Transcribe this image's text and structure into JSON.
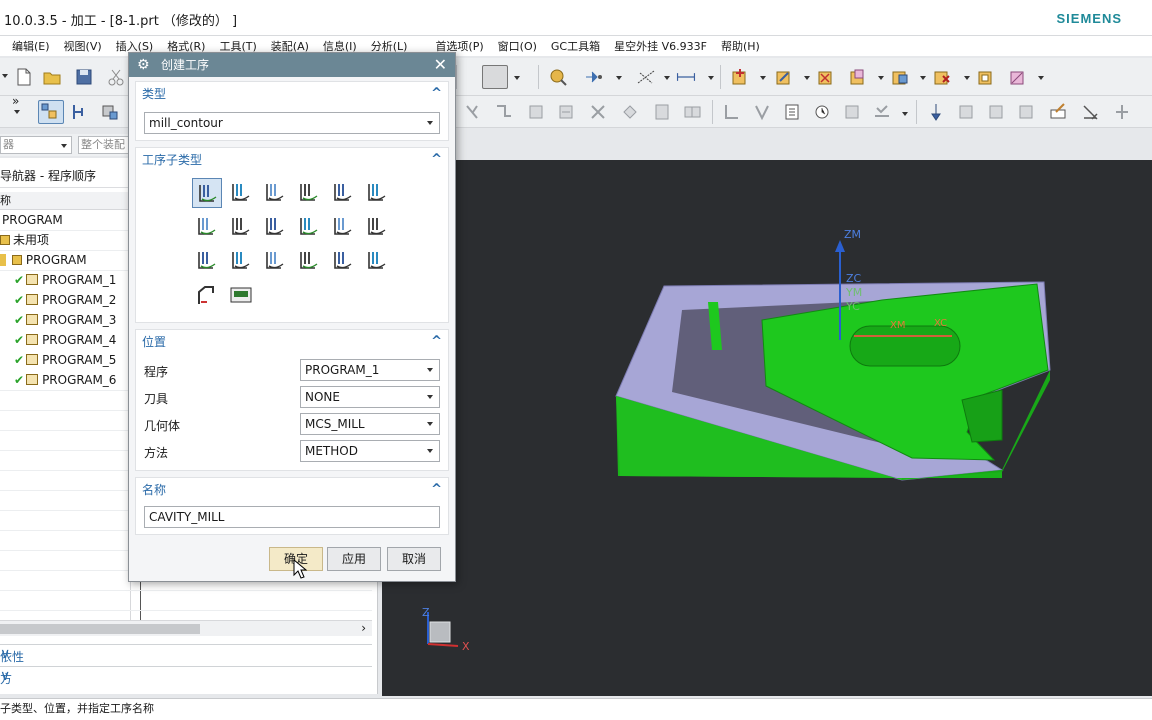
{
  "window": {
    "title": "10.0.3.5 - 加工 - [8-1.prt （修改的） ]",
    "brand": "SIEMENS"
  },
  "menubar": {
    "items": [
      "编辑(E)",
      "视图(V)",
      "插入(S)",
      "格式(R)",
      "工具(T)",
      "装配(A)",
      "信息(I)",
      "分析(L)",
      "首选项(P)",
      "窗口(O)",
      "GC工具箱",
      "星空外挂 V6.933F",
      "帮助(H)"
    ]
  },
  "toolbar2": {
    "filter_placeholder": "器",
    "assembly_placeholder": "整个装配"
  },
  "navigator": {
    "title": "导航器 - 程序顺序",
    "column_header": "称",
    "items": [
      {
        "label": "PROGRAM",
        "checked": false
      },
      {
        "label": "未用项",
        "checked": false
      },
      {
        "label": "PROGRAM",
        "checked": false
      },
      {
        "label": "PROGRAM_1",
        "checked": true
      },
      {
        "label": "PROGRAM_2",
        "checked": true
      },
      {
        "label": "PROGRAM_3",
        "checked": true
      },
      {
        "label": "PROGRAM_4",
        "checked": true
      },
      {
        "label": "PROGRAM_5",
        "checked": true
      },
      {
        "label": "PROGRAM_6",
        "checked": true
      }
    ],
    "sections": [
      "依性",
      "方"
    ]
  },
  "dialog": {
    "title": "创建工序",
    "type": {
      "header": "类型",
      "value": "mill_contour"
    },
    "subtype": {
      "header": "工序子类型",
      "icons": [
        "cavity-mill-icon",
        "plunge-mill-icon",
        "corner-rough-icon",
        "rest-mill-icon",
        "zlevel-profile-icon",
        "zlevel-corner-icon",
        "fixed-contour-icon",
        "contour-area-icon",
        "contour-surface-area-icon",
        "streamline-icon",
        "contour-area-nonsteep-icon",
        "contour-area-dir-steep-icon",
        "flowcut-single-icon",
        "flowcut-multiple-icon",
        "flowcut-ref-tool-icon",
        "flowcut-smooth-icon",
        "solid-profile-3d-icon",
        "contour-text-icon",
        "generic-motion-icon",
        "mill-user-icon"
      ],
      "selected_index": 0
    },
    "location": {
      "header": "位置",
      "fields": [
        {
          "label": "程序",
          "value": "PROGRAM_1"
        },
        {
          "label": "刀具",
          "value": "NONE"
        },
        {
          "label": "几何体",
          "value": "MCS_MILL"
        },
        {
          "label": "方法",
          "value": "METHOD"
        }
      ]
    },
    "name": {
      "header": "名称",
      "value": "CAVITY_MILL"
    },
    "buttons": {
      "ok": "确定",
      "apply": "应用",
      "cancel": "取消"
    }
  },
  "viewport": {
    "axes": {
      "zm": "ZM",
      "zc": "ZC",
      "ym": "YM",
      "yc": "YC",
      "xm": "XM",
      "xc": "XC"
    },
    "triad": {
      "z": "Z",
      "x": "X"
    },
    "part_color": "#1ec81e",
    "top_color": "#a7a6d6",
    "background": "#2b2d30"
  },
  "statusbar": {
    "text": "子类型、位置，并指定工序名称"
  }
}
